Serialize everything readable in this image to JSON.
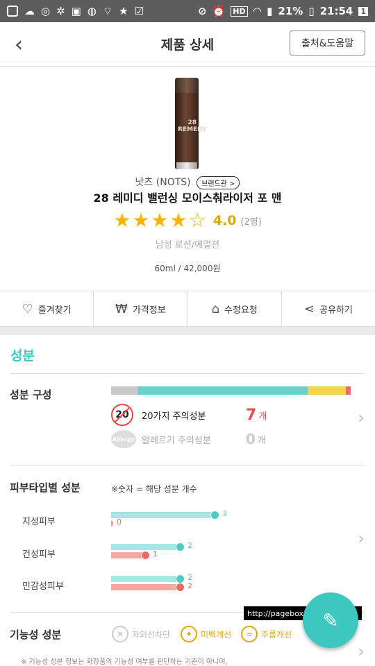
{
  "status": {
    "battery": "21%",
    "time": "21:54",
    "notif_badge": "1",
    "hd_label": "HD"
  },
  "header": {
    "title": "제품 상세",
    "source_button": "출처&도움말"
  },
  "product": {
    "bottle_label": "28 REMEDY",
    "brand": "낫츠 (NOTS)",
    "brand_pill": "브랜드관 >",
    "name": "28 레미디 밸런싱 모이스춰라이저 포 맨",
    "rating_value": "4.0",
    "rating_stars": 4,
    "rating_count": "(2명)",
    "category": "남성 로션/에멀젼",
    "volume_price": "60ml / 42,000원"
  },
  "actions": [
    {
      "label": "즐겨찾기",
      "icon": "heart-icon"
    },
    {
      "label": "가격정보",
      "icon": "won-icon"
    },
    {
      "label": "수정요청",
      "icon": "request-icon"
    },
    {
      "label": "공유하기",
      "icon": "share-icon"
    }
  ],
  "ingredients": {
    "section_title": "성분",
    "composition_label": "성분 구성",
    "composition_fractions": [
      0.11,
      0.71,
      0.16,
      0.02
    ],
    "composition_colors": [
      "#c9c9c9",
      "#67d2cc",
      "#f2d34a",
      "#ef6b6b"
    ],
    "warning20_badge": "20",
    "warning20_label": "20가지 주의성분",
    "warning20_count": "7",
    "warning20_unit": "개",
    "allergy_badge": "Allergy",
    "allergy_label": "알레르기 주의성분",
    "allergy_count": "0",
    "allergy_unit": "개",
    "skin_label": "피부타입별 성분",
    "skin_note": "※숫자 = 해당 성분 개수",
    "skin_types": [
      {
        "label": "지성피부",
        "good": 3,
        "bad": 0
      },
      {
        "label": "건성피부",
        "good": 2,
        "bad": 1
      },
      {
        "label": "민감성피부",
        "good": 2,
        "bad": 2
      }
    ],
    "functional_label": "기능성 성분",
    "functional_items": [
      {
        "label": "자외선차단",
        "icon": "close-circle-icon",
        "color": "#bbbbbb"
      },
      {
        "label": "미백개선",
        "icon": "bulb-icon",
        "color": "#e0a800"
      },
      {
        "label": "주름개선",
        "icon": "wrinkle-icon",
        "color": "#e0a800"
      }
    ],
    "footnote": "※ 기능성 성분 정보는 화장품의 기능성 여부를 판단하는 기준이 아니며,"
  },
  "watermark": "http://pagebox.tistory.com"
}
